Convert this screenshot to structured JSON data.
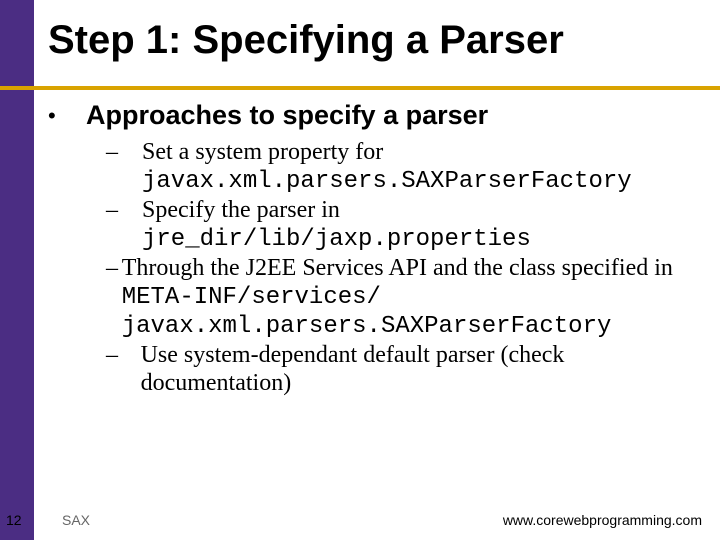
{
  "title": "Step 1: Specifying a Parser",
  "heading": "Approaches to specify a parser",
  "items": [
    {
      "text": "Set a system property for ",
      "code": "javax.xml.parsers.SAXParserFactory"
    },
    {
      "text": "Specify the parser in ",
      "code": "jre_dir/lib/jaxp.properties"
    },
    {
      "text": "Through the J2EE Services API and the class specified in ",
      "code": "META-INF/services/ javax.xml.parsers.SAXParserFactory"
    },
    {
      "text": "Use  system-dependant default parser (check documentation)",
      "code": ""
    }
  ],
  "footer": {
    "page": "12",
    "left": "SAX",
    "right": "www.corewebprogramming.com"
  }
}
